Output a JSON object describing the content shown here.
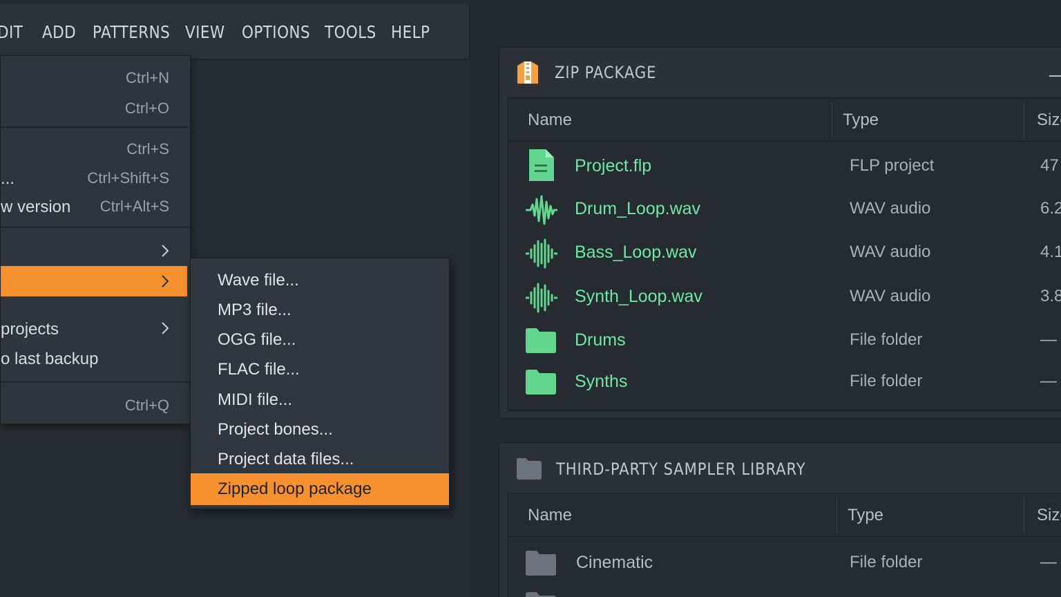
{
  "menubar": {
    "items": [
      "DIT",
      "ADD",
      "PATTERNS",
      "VIEW",
      "OPTIONS",
      "TOOLS",
      "HELP"
    ]
  },
  "file_menu": {
    "items": [
      {
        "label": "",
        "shortcut": "Ctrl+N"
      },
      {
        "label": "",
        "shortcut": "Ctrl+O"
      },
      {
        "label": "",
        "shortcut": "Ctrl+S"
      },
      {
        "label": "...",
        "shortcut": "Ctrl+Shift+S"
      },
      {
        "label": "w version",
        "shortcut": "Ctrl+Alt+S"
      },
      {
        "label": "",
        "shortcut": ""
      },
      {
        "label": "",
        "shortcut": ""
      },
      {
        "label": "projects",
        "shortcut": ""
      },
      {
        "label": "o last backup",
        "shortcut": ""
      },
      {
        "label": "",
        "shortcut": "Ctrl+Q"
      }
    ]
  },
  "export_submenu": {
    "items": [
      "Wave file...",
      "MP3 file...",
      "OGG file...",
      "FLAC file...",
      "MIDI file...",
      "Project bones...",
      "Project data files...",
      "Zipped loop package"
    ],
    "active_index": 7
  },
  "zip_panel": {
    "title": "ZIP PACKAGE",
    "columns": [
      "Name",
      "Type",
      "Size"
    ],
    "rows": [
      {
        "icon": "flp-file-icon",
        "name": "Project.flp",
        "type": "FLP project",
        "size": "47"
      },
      {
        "icon": "waveform-icon",
        "name": "Drum_Loop.wav",
        "type": "WAV audio",
        "size": "6.2"
      },
      {
        "icon": "waveform-icon",
        "name": "Bass_Loop.wav",
        "type": "WAV audio",
        "size": "4.1"
      },
      {
        "icon": "waveform-icon",
        "name": "Synth_Loop.wav",
        "type": "WAV audio",
        "size": "3.8"
      },
      {
        "icon": "folder-icon",
        "name": "Drums",
        "type": "File folder",
        "size": "—"
      },
      {
        "icon": "folder-icon",
        "name": "Synths",
        "type": "File folder",
        "size": "—"
      }
    ]
  },
  "sampler_panel": {
    "title": "THIRD-PARTY SAMPLER LIBRARY",
    "columns": [
      "Name",
      "Type",
      "Size"
    ],
    "rows": [
      {
        "icon": "folder-icon",
        "name": "Cinematic",
        "type": "File folder",
        "size": "—"
      }
    ]
  },
  "colors": {
    "accent": "#f7902e",
    "file_green": "#6fe8a3",
    "background": "#24292f"
  }
}
